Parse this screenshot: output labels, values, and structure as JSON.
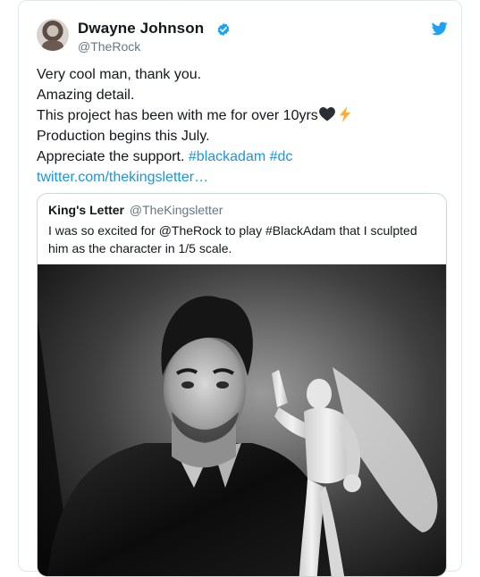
{
  "tweet": {
    "author_name": "Dwayne Johnson",
    "author_handle": "@TheRock",
    "lines": [
      "Very cool man, thank you.",
      "Amazing detail.",
      "This project has been with me for over 10yrs",
      "Production begins this July.",
      "Appreciate the support."
    ],
    "hashtags": [
      "#blackadam",
      "#dc"
    ],
    "link": "twitter.com/thekingsletter…",
    "emojis": [
      "black-heart",
      "lightning-bolt"
    ]
  },
  "quoted_tweet": {
    "author_name": "King's Letter",
    "author_handle": "@TheKingsletter",
    "text": "I was so excited for @TheRock to play #BlackAdam that I sculpted him as the character in 1/5 scale."
  },
  "colors": {
    "link": "#1b95e0",
    "verified": "#1da1f2",
    "twitter_bird": "#1da1f2",
    "text": "#14171a",
    "secondary_text": "#657786"
  },
  "icons": {
    "verified": "verified-badge-icon",
    "brand": "twitter-bird-icon"
  }
}
